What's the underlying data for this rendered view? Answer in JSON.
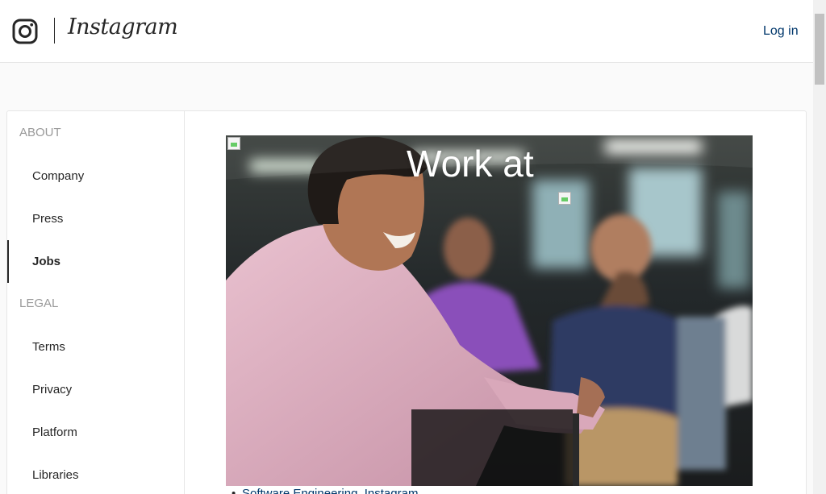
{
  "header": {
    "brand": "Instagram",
    "login_label": "Log in"
  },
  "sidebar": {
    "about_heading": "ABOUT",
    "about_items": [
      "Company",
      "Press",
      "Jobs"
    ],
    "legal_heading": "LEGAL",
    "legal_items": [
      "Terms",
      "Privacy",
      "Platform",
      "Libraries"
    ],
    "active_item": "Jobs"
  },
  "main": {
    "hero_title": "Work at",
    "job_listing": "Software Engineering, Instagram"
  },
  "icons": {
    "logo": "instagram-camera-icon",
    "broken_image": "broken-image-icon"
  },
  "colors": {
    "link": "#00376b",
    "text": "#262626",
    "muted": "#999999"
  }
}
